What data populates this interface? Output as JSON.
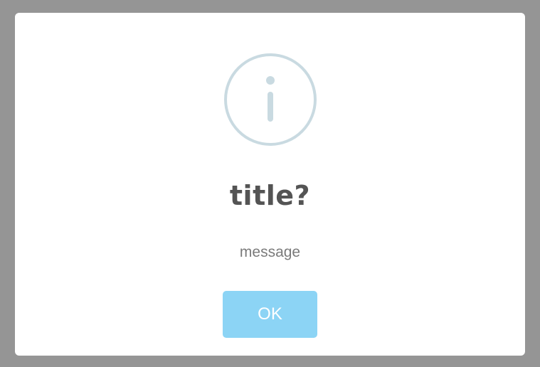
{
  "dialog": {
    "icon": "info-icon",
    "title": "title?",
    "message": "message",
    "ok_label": "OK"
  },
  "colors": {
    "backdrop": "#959595",
    "dialog_background": "#ffffff",
    "icon_color": "#c9dae1",
    "title_color": "#545454",
    "message_color": "#7a7a7a",
    "button_color": "#8cd4f5",
    "button_text_color": "#ffffff"
  }
}
